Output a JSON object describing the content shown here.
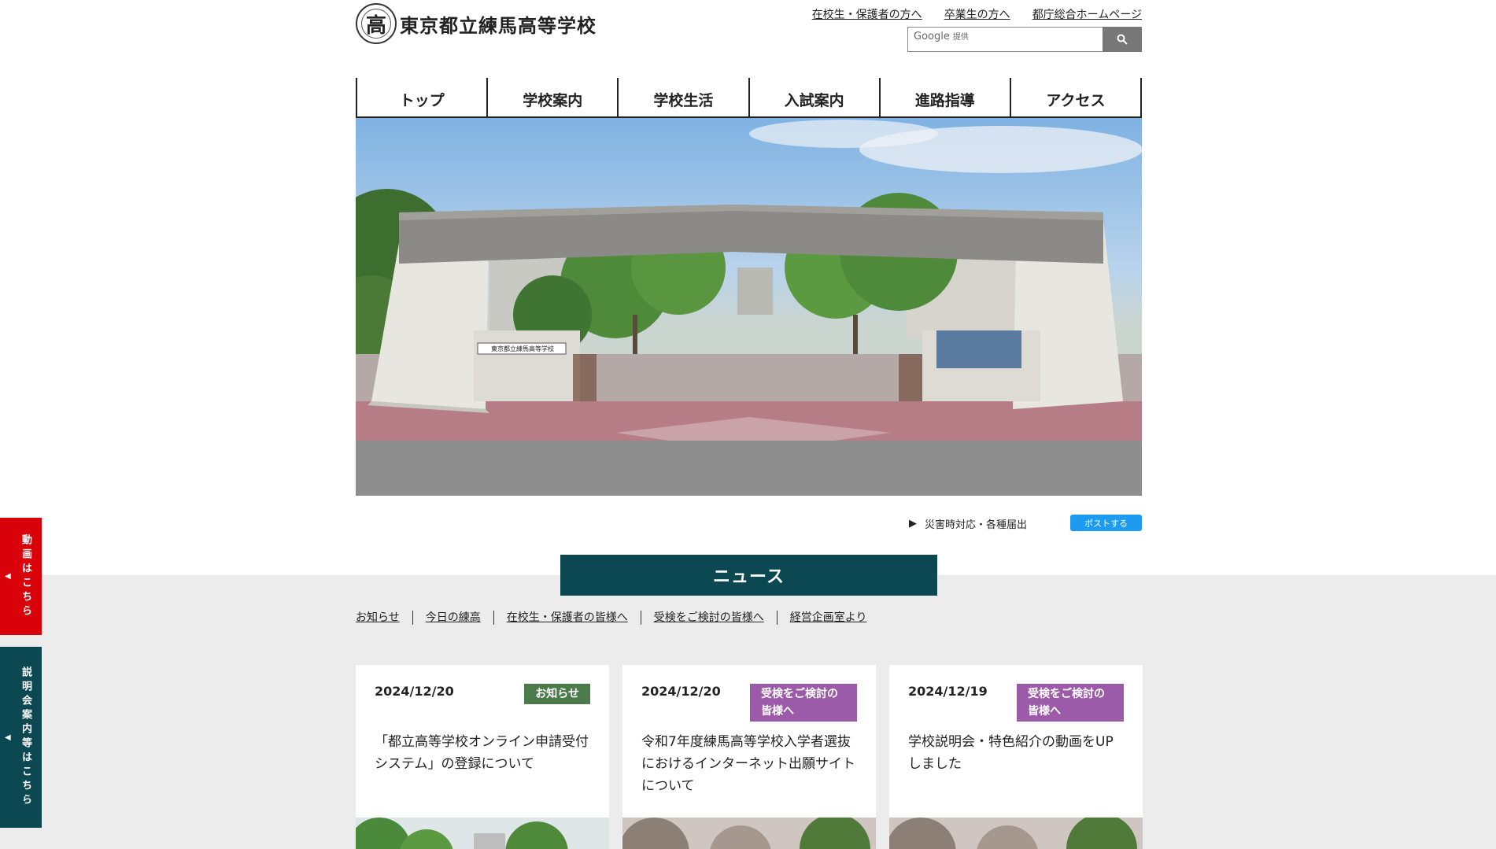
{
  "header": {
    "school_name": "東京都立練馬高等学校",
    "logo_char": "高",
    "links": [
      "在校生・保護者の方へ",
      "卒業生の方へ",
      "都庁総合ホームページ"
    ],
    "search": {
      "brand": "Google",
      "suffix": "提供"
    }
  },
  "nav": [
    "トップ",
    "学校案内",
    "学校生活",
    "入試案内",
    "進路指導",
    "アクセス"
  ],
  "hero": {
    "sign_text": "東京都立練馬高等学校"
  },
  "below_hero": {
    "disaster_link": "災害時対応・各種届出",
    "post_button": "ポストする"
  },
  "news": {
    "title": "ニュース",
    "categories": [
      "お知らせ",
      "今日の練高",
      "在校生・保護者の皆様へ",
      "受検をご検討の皆様へ",
      "経営企画室より"
    ],
    "cards": [
      {
        "date": "2024/12/20",
        "tag": "お知らせ",
        "tag_color": "#4b7a4b",
        "text": "「都立高等学校オンライン申請受付システム」の登録について"
      },
      {
        "date": "2024/12/20",
        "tag": "受検をご検討の皆様へ",
        "tag_color": "#9c5ba8",
        "text": "令和7年度練馬高等学校入学者選抜におけるインターネット出願サイトについて"
      },
      {
        "date": "2024/12/19",
        "tag": "受検をご検討の皆様へ",
        "tag_color": "#9c5ba8",
        "text": "学校説明会・特色紹介の動画をUPしました"
      }
    ]
  },
  "side_tabs": [
    {
      "label": "動画はこちら",
      "color": "#d9020a"
    },
    {
      "label": "説明会案内等はこちら",
      "color": "#0c4852"
    }
  ],
  "colors": {
    "accent": "#0c4852",
    "gray_bg": "#ececec",
    "post_blue": "#1d9bf0"
  }
}
